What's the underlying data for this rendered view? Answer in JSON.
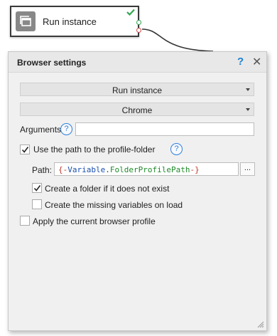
{
  "node": {
    "label": "Run instance",
    "icon": "instance-icon",
    "status_icon": "check-icon",
    "colors": {
      "ok": "#2fa84f",
      "error": "#d94a4a"
    }
  },
  "dialog": {
    "title": "Browser settings",
    "help_icon": "?",
    "close_icon": "✕",
    "action_select": {
      "value": "Run instance"
    },
    "browser_select": {
      "value": "Chrome"
    },
    "arguments": {
      "label": "Arguments",
      "value": ""
    },
    "use_profile": {
      "label": "Use the path to the profile-folder",
      "checked": true
    },
    "path": {
      "label": "Path:",
      "value": {
        "open": "{-",
        "var": "Variable",
        "dot": ".",
        "name": "FolderProfilePath",
        "close": "-}"
      },
      "browse_label": "..."
    },
    "create_folder": {
      "label": "Create a folder if it does not exist",
      "checked": true
    },
    "create_vars": {
      "label": "Create the missing variables on load",
      "checked": false
    },
    "apply_profile": {
      "label": "Apply the current browser profile",
      "checked": false
    },
    "accent": "#1e7fd2"
  }
}
